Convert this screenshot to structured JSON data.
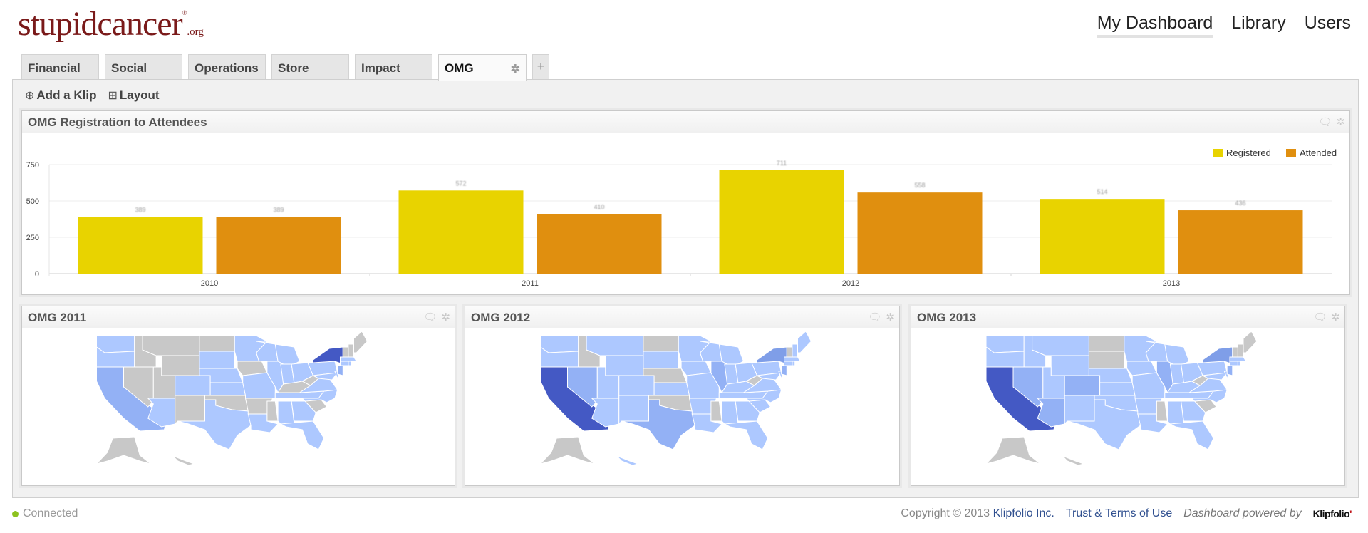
{
  "logo": {
    "name": "stupidcancer",
    "suffix": ".org",
    "mark": "®"
  },
  "topnav": [
    {
      "label": "My Dashboard",
      "active": true
    },
    {
      "label": "Library",
      "active": false
    },
    {
      "label": "Users",
      "active": false
    }
  ],
  "tabs": [
    {
      "label": "Financial"
    },
    {
      "label": "Social"
    },
    {
      "label": "Operations"
    },
    {
      "label": "Store"
    },
    {
      "label": "Impact"
    },
    {
      "label": "OMG",
      "active": true
    }
  ],
  "icons": {
    "tab_settings": "gear-icon",
    "add_tab": "plus-icon",
    "add_klip": "circle-plus-icon",
    "layout": "grid-icon",
    "comment": "comment-icon",
    "settings": "gear-icon"
  },
  "toolbar": {
    "add_klip": "Add a Klip",
    "layout": "Layout"
  },
  "chart_klip": {
    "title": "OMG Registration to Attendees"
  },
  "chart_data": {
    "type": "bar",
    "title": "OMG Registration to Attendees",
    "categories": [
      "2010",
      "2011",
      "2012",
      "2013"
    ],
    "series": [
      {
        "name": "Registered",
        "color": "#e8d300",
        "values": [
          389,
          572,
          711,
          514
        ]
      },
      {
        "name": "Attended",
        "color": "#e08f0f",
        "values": [
          389,
          410,
          558,
          436
        ]
      }
    ],
    "yticks": [
      0,
      250,
      500,
      750
    ],
    "ylim": [
      0,
      750
    ],
    "xlabel": "",
    "ylabel": "",
    "grid": true,
    "legend": "top-right",
    "data_labels": [
      "389",
      "389",
      "572",
      "410",
      "711",
      "558",
      "514",
      "436"
    ]
  },
  "map_colors": {
    "none": "#c8c8c8",
    "low": "#adc8ff",
    "mid": "#93b1f5",
    "high": "#7f9ee8",
    "max": "#4459c4"
  },
  "maps": [
    {
      "title": "OMG 2011",
      "states": {
        "WA": "low",
        "OR": "low",
        "CA": "mid",
        "NV": "none",
        "ID": "none",
        "MT": "none",
        "WY": "none",
        "UT": "none",
        "AZ": "low",
        "CO": "low",
        "NM": "none",
        "ND": "none",
        "SD": "low",
        "NE": "low",
        "KS": "low",
        "OK": "none",
        "TX": "low",
        "MN": "low",
        "IA": "none",
        "MO": "low",
        "AR": "none",
        "LA": "low",
        "WI": "low",
        "IL": "low",
        "MI": "low",
        "IN": "low",
        "OH": "low",
        "KY": "none",
        "TN": "low",
        "MS": "none",
        "AL": "low",
        "GA": "low",
        "FL": "low",
        "SC": "none",
        "NC": "low",
        "VA": "low",
        "WV": "none",
        "PA": "low",
        "NY": "max",
        "VT": "none",
        "NH": "none",
        "ME": "none",
        "MA": "low",
        "CT": "low",
        "RI": "low",
        "NJ": "mid",
        "DE": "low",
        "MD": "low",
        "AK": "none",
        "HI": "none"
      }
    },
    {
      "title": "OMG 2012",
      "states": {
        "WA": "low",
        "OR": "low",
        "CA": "max",
        "NV": "mid",
        "ID": "none",
        "MT": "low",
        "WY": "low",
        "UT": "low",
        "AZ": "low",
        "CO": "low",
        "NM": "low",
        "ND": "none",
        "SD": "low",
        "NE": "none",
        "KS": "low",
        "OK": "none",
        "TX": "mid",
        "MN": "low",
        "IA": "low",
        "MO": "low",
        "AR": "low",
        "LA": "low",
        "WI": "low",
        "IL": "mid",
        "MI": "low",
        "IN": "low",
        "OH": "low",
        "KY": "low",
        "TN": "low",
        "MS": "none",
        "AL": "low",
        "GA": "low",
        "FL": "low",
        "SC": "low",
        "NC": "low",
        "VA": "low",
        "WV": "none",
        "PA": "low",
        "NY": "high",
        "VT": "none",
        "NH": "low",
        "ME": "low",
        "MA": "low",
        "CT": "low",
        "RI": "low",
        "NJ": "mid",
        "DE": "low",
        "MD": "low",
        "AK": "none",
        "HI": "low"
      }
    },
    {
      "title": "OMG 2013",
      "states": {
        "WA": "low",
        "OR": "low",
        "CA": "max",
        "NV": "mid",
        "ID": "low",
        "MT": "low",
        "WY": "low",
        "UT": "low",
        "AZ": "mid",
        "CO": "mid",
        "NM": "low",
        "ND": "none",
        "SD": "none",
        "NE": "low",
        "KS": "low",
        "OK": "low",
        "TX": "low",
        "MN": "low",
        "IA": "low",
        "MO": "low",
        "AR": "low",
        "LA": "low",
        "WI": "low",
        "IL": "mid",
        "MI": "low",
        "IN": "low",
        "OH": "low",
        "KY": "low",
        "TN": "low",
        "MS": "none",
        "AL": "low",
        "GA": "low",
        "FL": "low",
        "SC": "none",
        "NC": "low",
        "VA": "low",
        "WV": "none",
        "PA": "low",
        "NY": "high",
        "VT": "none",
        "NH": "none",
        "ME": "none",
        "MA": "low",
        "CT": "low",
        "RI": "low",
        "NJ": "mid",
        "DE": "low",
        "MD": "low",
        "AK": "none",
        "HI": "none"
      }
    }
  ],
  "footer": {
    "status": "Connected",
    "copyright": "Copyright © 2013",
    "company_link": "Klipfolio Inc.",
    "terms_link": "Trust & Terms of Use",
    "powered_by": "Dashboard powered by",
    "brand": "Klipfolio"
  }
}
